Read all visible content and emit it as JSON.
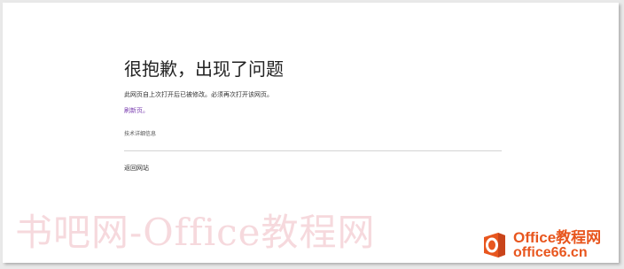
{
  "error_page": {
    "title": "很抱歉，出现了问题",
    "message": "此网页自上次打开后已被修改。必须再次打开该网页。",
    "refresh_link": "刷新页。",
    "details_link": "技术详细信息",
    "back_link": "返回网站"
  },
  "watermark": {
    "text": "书吧网-Office教程网"
  },
  "badge": {
    "line1": "Office教程网",
    "line2": "office66.cn",
    "logo_letter": "O",
    "color": "#e8561e"
  }
}
